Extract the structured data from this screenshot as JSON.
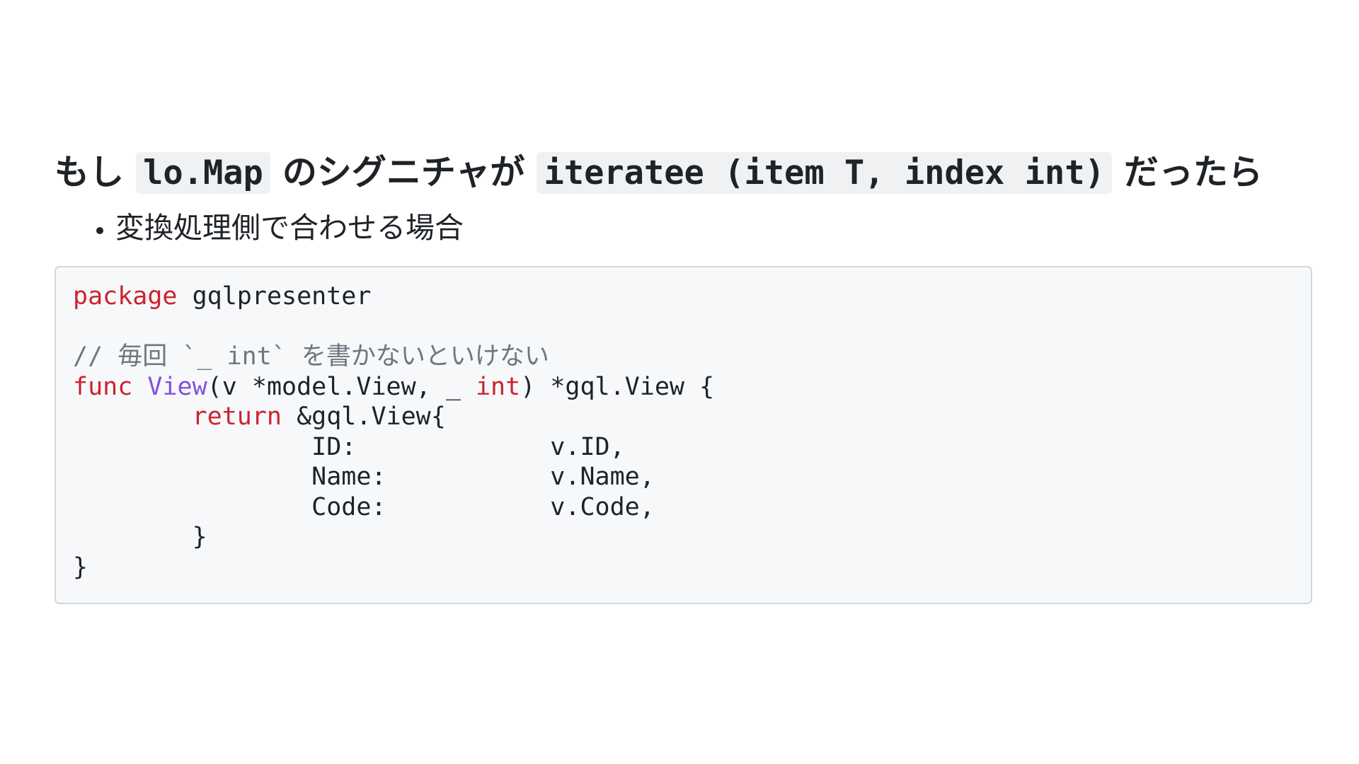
{
  "heading": {
    "prefix": "もし ",
    "code1": "lo.Map",
    "middle": " のシグニチャが ",
    "code2": "iteratee (item T, index int)",
    "suffix": " だったら"
  },
  "bullets": [
    "変換処理側で合わせる場合"
  ],
  "code": {
    "line1_kw": "package",
    "line1_rest": " gqlpresenter",
    "comment": "// 毎回 `_ int` を書かないといけない",
    "line4_kw": "func",
    "line4_fn": "View",
    "line4_mid": "(v *model.View, _ ",
    "line4_type": "int",
    "line4_end": ") *gql.View {",
    "line5_indent": "\t",
    "line5_kw": "return",
    "line5_rest": " &gql.View{",
    "field_id": "\t\tID:\t\tv.ID,",
    "field_name": "\t\tName:\t\tv.Name,",
    "field_code": "\t\tCode:\t\tv.Code,",
    "inner_close": "\t}",
    "outer_close": "}"
  },
  "colors": {
    "keyword": "#cf222e",
    "function": "#8250df",
    "comment": "#6e7781",
    "code_background": "#f6f8fa"
  }
}
